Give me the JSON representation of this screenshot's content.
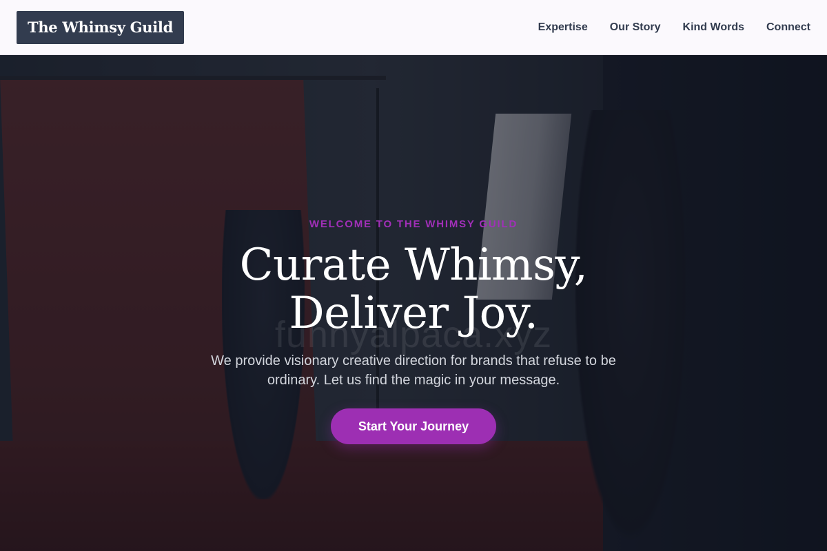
{
  "header": {
    "brand": "The Whimsy Guild",
    "nav": [
      {
        "label": "Expertise"
      },
      {
        "label": "Our Story"
      },
      {
        "label": "Kind Words"
      },
      {
        "label": "Connect"
      }
    ]
  },
  "hero": {
    "eyebrow": "WELCOME TO THE WHIMSY GUILD",
    "headline_line1": "Curate Whimsy,",
    "headline_line2": "Deliver Joy.",
    "subtext": "We provide visionary creative direction for brands that refuse to be ordinary. Let us find the magic in your message.",
    "cta_label": "Start Your Journey",
    "watermark": "funnyalpaca.xyz"
  },
  "colors": {
    "nav_background": "#fbf9fd",
    "brand_background": "#323c4f",
    "accent": "#9d2fb3",
    "eyebrow": "#a12fb8",
    "headline": "#ffffff",
    "subtext": "#d3d6dd"
  }
}
